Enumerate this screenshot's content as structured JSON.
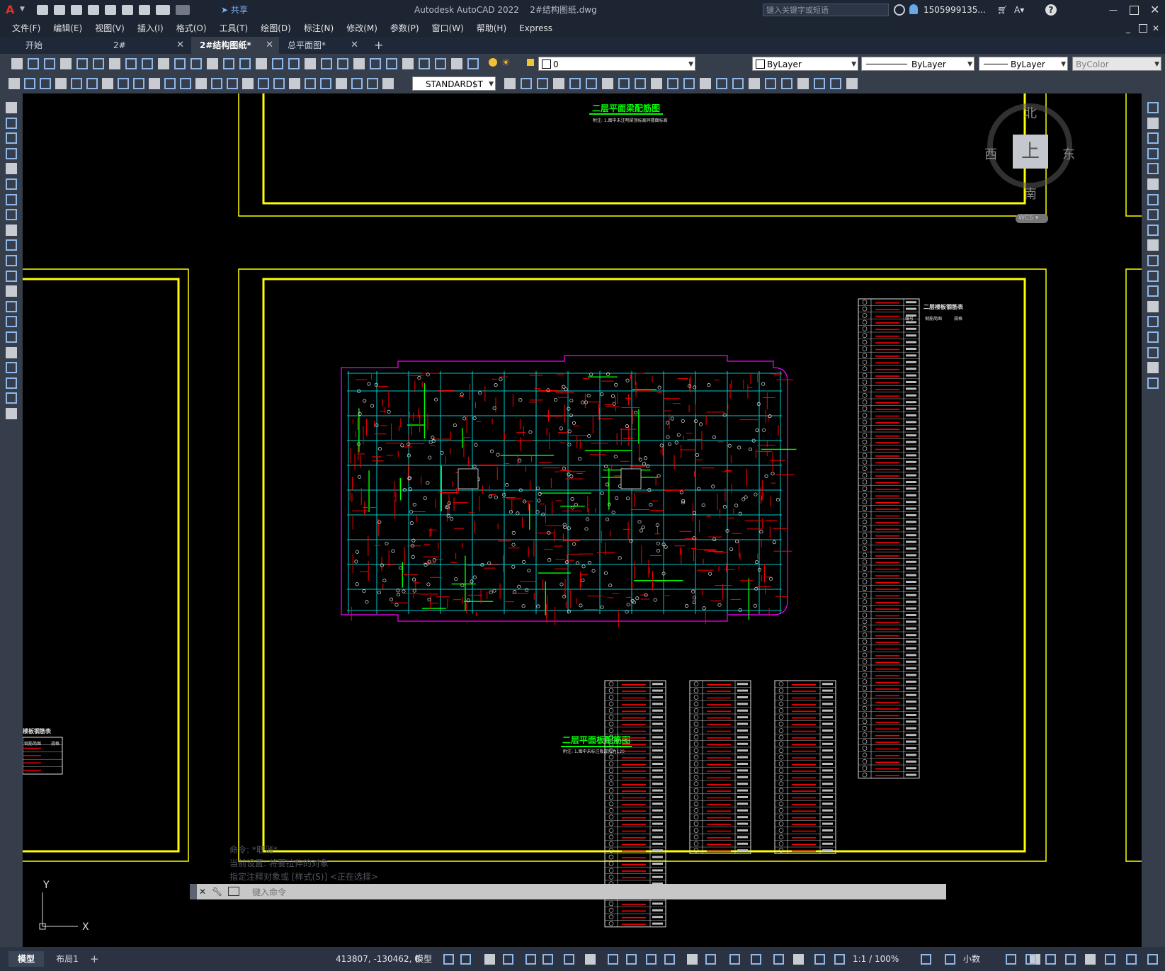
{
  "app": {
    "title": "Autodesk AutoCAD 2022",
    "document": "2#结构图纸.dwg",
    "search_placeholder": "键入关键字或短语",
    "user": "1505999135...",
    "share": "共享"
  },
  "menu": [
    "文件(F)",
    "编辑(E)",
    "视图(V)",
    "插入(I)",
    "格式(O)",
    "工具(T)",
    "绘图(D)",
    "标注(N)",
    "修改(M)",
    "参数(P)",
    "窗口(W)",
    "帮助(H)",
    "Express"
  ],
  "tabs": [
    {
      "label": "开始",
      "closable": false
    },
    {
      "label": "2#",
      "closable": true
    },
    {
      "label": "2#结构图纸*",
      "closable": true,
      "active": true
    },
    {
      "label": "总平面图*",
      "closable": true
    }
  ],
  "properties": {
    "layer": "0",
    "color": "ByLayer",
    "linetype": "ByLayer",
    "lineweight": "ByLayer",
    "plotstyle": "ByColor",
    "textstyle": "STANDARD$T"
  },
  "viewcube": {
    "north": "北",
    "south": "南",
    "east": "东",
    "west": "西",
    "top": "上",
    "wcs": "WCS"
  },
  "drawing": {
    "beam_title": "二层平面梁配筋图",
    "beam_note": "附注: 1.图中未注明梁顶标高同楼面标高",
    "slab_title": "二层平面板配筋图",
    "slab_note": "附注: 1.图中未标注板厚均为120",
    "table_title": "二层楼板钢筋表",
    "table_headers": [
      "编号",
      "钢筋简图",
      "规格"
    ],
    "left_table_title": "楼板钢筋表",
    "left_table_headers": [
      "钢筋简图",
      "规格"
    ]
  },
  "ucs": {
    "x": "X",
    "y": "Y"
  },
  "command": {
    "history": [
      "命令: *取消*",
      "当前设置: 将要拉伸的对象",
      "指定注释对象或 [样式(S)] <正在选择>"
    ],
    "placeholder": "键入命令"
  },
  "layout_tabs": [
    "模型",
    "布局1"
  ],
  "status": {
    "coords": "413807, -130462, 0",
    "model": "模型",
    "scale": "1:1 / 100%",
    "units": "小数"
  },
  "colors": {
    "accent": "#3c7dd9",
    "frame_yellow": "#ffff00",
    "title_green": "#00ff00",
    "rebar_red": "#ff0000",
    "beam_cyan": "#00c8c8",
    "wall_magenta": "#ff00ff"
  }
}
